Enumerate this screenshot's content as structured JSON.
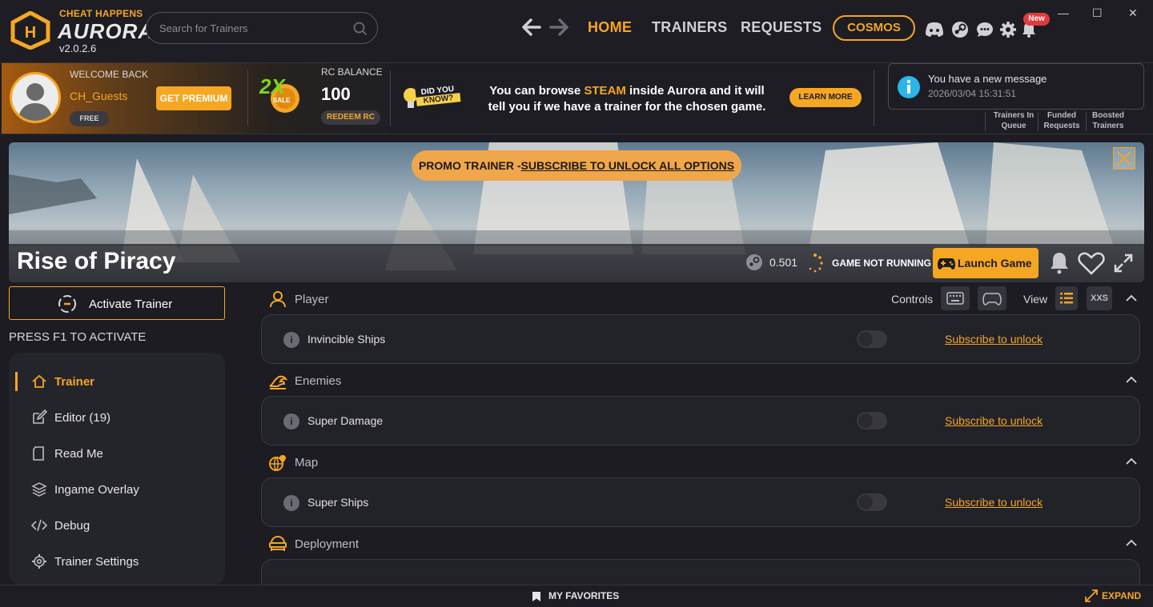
{
  "brand": {
    "top": "CHEAT HAPPENS",
    "name": "AURORA",
    "version": "v2.0.2.6"
  },
  "search": {
    "placeholder": "Search for Trainers"
  },
  "nav": {
    "home": "HOME",
    "trainers": "TRAINERS",
    "requests": "REQUESTS",
    "cosmos": "COSMOS"
  },
  "notifications": {
    "badge": "New"
  },
  "window": {
    "minimize": "—",
    "maximize": "☐",
    "close": "✕"
  },
  "user": {
    "welcome": "WELCOME BACK",
    "name": "CH_Guests",
    "tier": "FREE",
    "premium_button": "GET PREMIUM"
  },
  "sale": {
    "multiplier": "2X",
    "label": "SALE"
  },
  "balance": {
    "label": "RC BALANCE",
    "value": "100",
    "redeem": "REDEEM RC"
  },
  "didyouknow": {
    "badge_line1": "DID YOU",
    "badge_line2": "KNOW?",
    "text_pre": "You can browse ",
    "text_highlight": "STEAM",
    "text_post": " inside Aurora and it will",
    "text_line2": "tell you if we have a trainer for the chosen game.",
    "button": "LEARN MORE"
  },
  "message": {
    "text": "You have a new message",
    "time": "2026/03/04 15:31:51"
  },
  "stats": [
    {
      "line1": "Trainers In",
      "line2": "Queue"
    },
    {
      "line1": "Funded",
      "line2": "Requests"
    },
    {
      "line1": "Boosted",
      "line2": "Trainers"
    }
  ],
  "banner": {
    "promo_prefix": "PROMO TRAINER -",
    "promo_link": "SUBSCRIBE TO UNLOCK ALL OPTIONS",
    "game_title": "Rise of Piracy",
    "steam_version": "0.501",
    "status": "GAME NOT RUNNING",
    "launch": "Launch Game"
  },
  "sidebar": {
    "activate": "Activate Trainer",
    "press": "PRESS F1 TO ACTIVATE",
    "items": [
      {
        "label": "Trainer",
        "active": true
      },
      {
        "label": "Editor (19)",
        "active": false
      },
      {
        "label": "Read Me",
        "active": false
      },
      {
        "label": "Ingame Overlay",
        "active": false
      },
      {
        "label": "Debug",
        "active": false
      },
      {
        "label": "Trainer Settings",
        "active": false
      }
    ]
  },
  "controls": {
    "label": "Controls",
    "view_label": "View",
    "xxs": "XXS"
  },
  "sections": [
    {
      "title": "Player",
      "options": [
        {
          "name": "Invincible Ships",
          "action": "Subscribe to unlock"
        }
      ]
    },
    {
      "title": "Enemies",
      "options": [
        {
          "name": "Super Damage",
          "action": "Subscribe to unlock"
        }
      ]
    },
    {
      "title": "Map",
      "options": [
        {
          "name": "Super Ships",
          "action": "Subscribe to unlock"
        }
      ]
    },
    {
      "title": "Deployment",
      "options": []
    }
  ],
  "footer": {
    "favorites": "MY FAVORITES",
    "expand": "EXPAND"
  },
  "colors": {
    "accent": "#f5a623",
    "background": "#1c1c22",
    "panel": "#24242b"
  }
}
